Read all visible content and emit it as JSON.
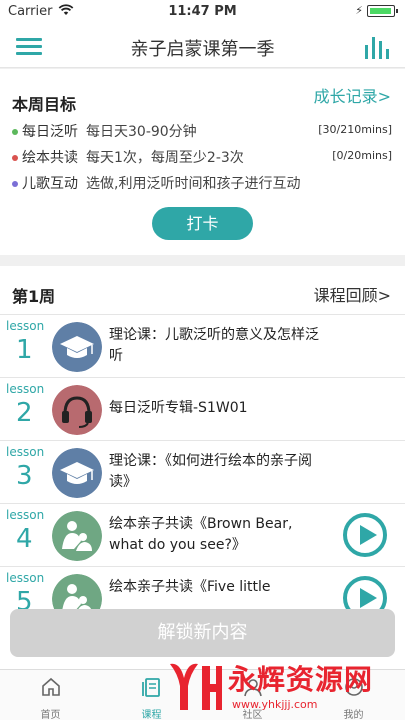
{
  "status_bar": {
    "carrier": "Carrier",
    "time": "11:47 PM"
  },
  "nav": {
    "title": "亲子启蒙课第一季"
  },
  "weekly_goals": {
    "heading": "本周目标",
    "growth_record": "成长记录>",
    "items": [
      {
        "name": "每日泛听",
        "desc": "每日天30-90分钟",
        "progress": "[30/210mins]",
        "color": "#5cb85c"
      },
      {
        "name": "绘本共读",
        "desc": "每天1次，每周至少2-3次",
        "progress": "[0/20mins]",
        "color": "#d9534f"
      },
      {
        "name": "儿歌互动",
        "desc": "选做,利用泛听时间和孩子进行互动",
        "progress": "",
        "color": "#7b6fd6"
      }
    ],
    "checkin_label": "打卡"
  },
  "week": {
    "title": "第1周",
    "review": "课程回顾>",
    "lessons": [
      {
        "tag": "lesson",
        "number": "1",
        "title": "理论课：儿歌泛听的意义及怎样泛听",
        "icon": "graduation-cap-icon",
        "color": "#5f7fa6",
        "playable": false
      },
      {
        "tag": "lesson",
        "number": "2",
        "title": "每日泛听专辑-S1W01",
        "icon": "headphones-icon",
        "color": "#b86a6f",
        "playable": false
      },
      {
        "tag": "lesson",
        "number": "3",
        "title": "理论课：《如何进行绘本的亲子阅读》",
        "icon": "graduation-cap-icon",
        "color": "#5f7fa6",
        "playable": false
      },
      {
        "tag": "lesson",
        "number": "4",
        "title": "绘本亲子共读《Brown Bear, what do you see?》",
        "icon": "parent-child-icon",
        "color": "#6fa783",
        "playable": true
      },
      {
        "tag": "lesson",
        "number": "5",
        "title": "绘本亲子共读《Five little",
        "icon": "parent-child-icon",
        "color": "#6fa783",
        "playable": true
      }
    ]
  },
  "unlock_label": "解锁新内容",
  "tabs": [
    {
      "label": "首页",
      "icon": "home-icon"
    },
    {
      "label": "课程",
      "icon": "course-icon"
    },
    {
      "label": "社区",
      "icon": "community-icon"
    },
    {
      "label": "我的",
      "icon": "profile-icon"
    }
  ],
  "watermark": {
    "text": "永辉资源网",
    "url": "www.yhkjjj.com"
  },
  "colors": {
    "accent": "#2fa7a7"
  }
}
